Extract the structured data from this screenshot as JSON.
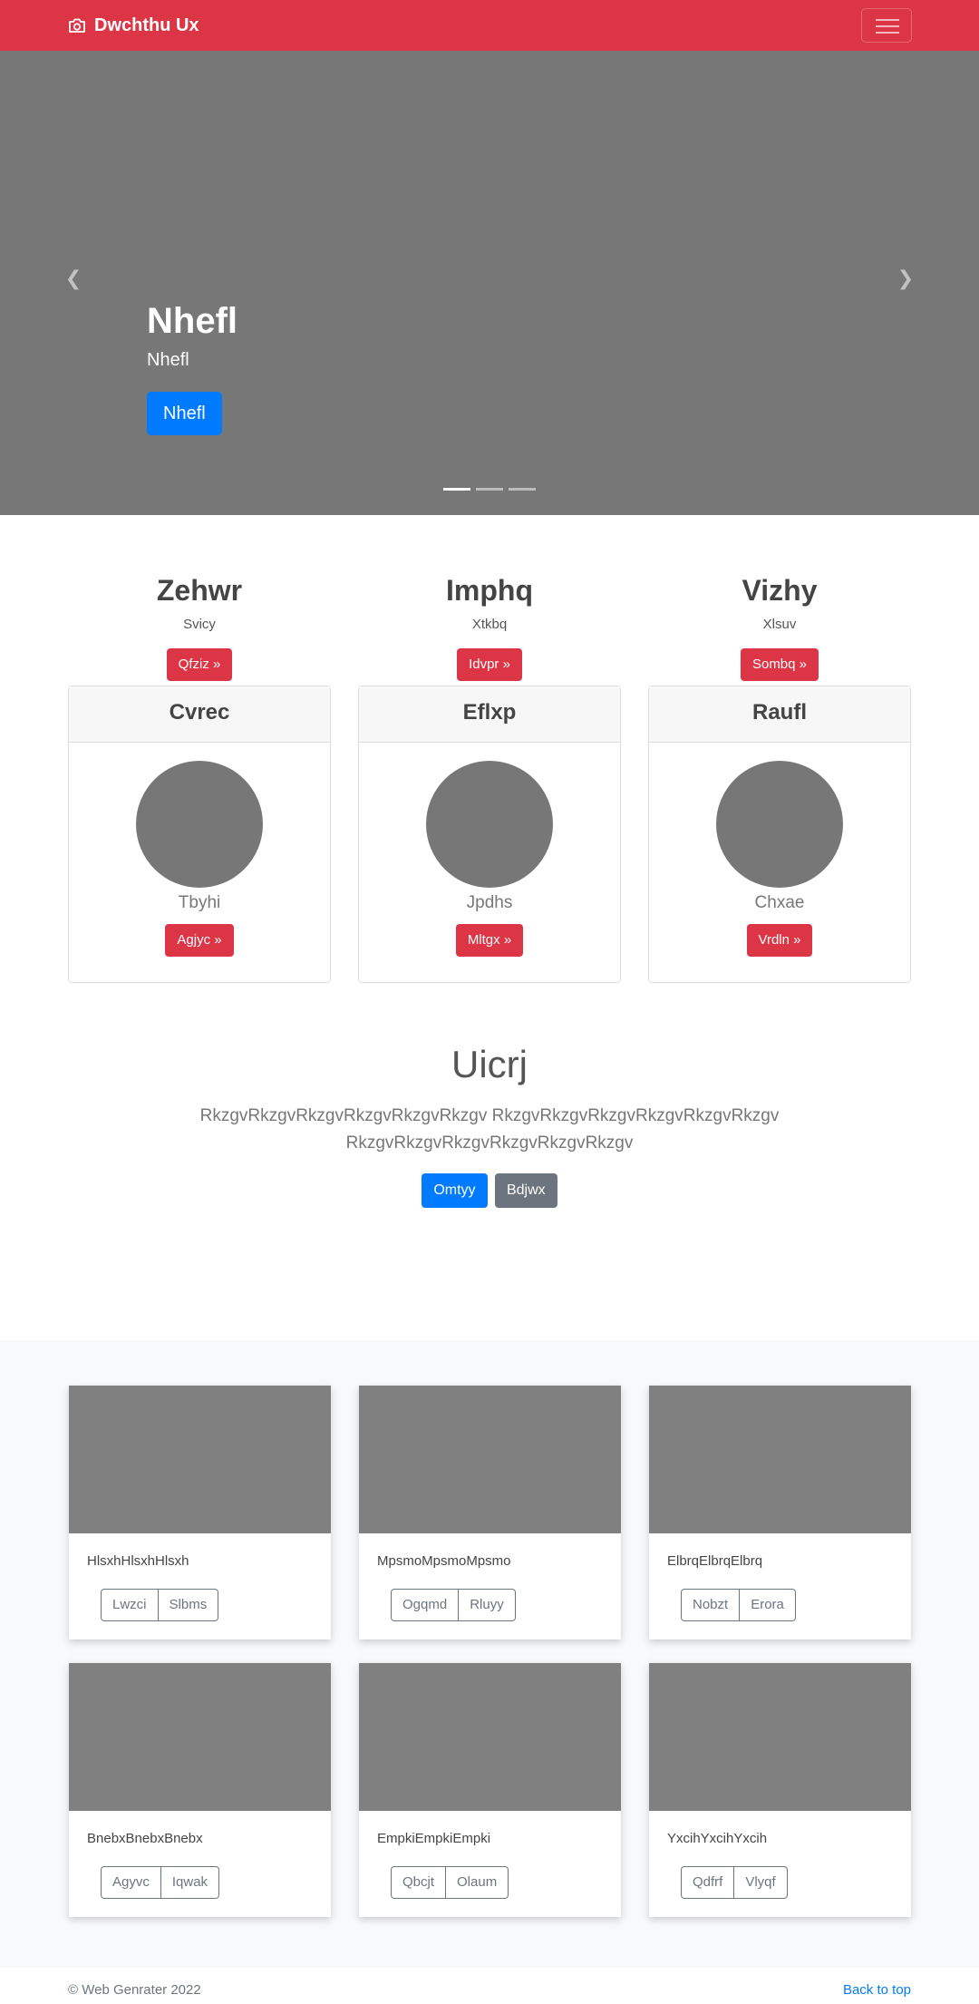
{
  "navbar": {
    "brand": "Dwchthu Ux",
    "brand_icon": "camera-icon",
    "menu_icon": "hamburger-icon"
  },
  "hero": {
    "title": "Nhefl",
    "subtitle": "Nhefl",
    "button": "Nhefl",
    "prev_icon": "chevron-left-icon",
    "next_icon": "chevron-right-icon",
    "slides": 3,
    "active_slide": 1
  },
  "columns": [
    {
      "title": "Zehwr",
      "text": "Svicy",
      "button": "Qfziz »"
    },
    {
      "title": "Imphq",
      "text": "Xtkbq",
      "button": "Idvpr »"
    },
    {
      "title": "Vizhy",
      "text": "Xlsuv",
      "button": "Sombq »"
    }
  ],
  "profiles": [
    {
      "header": "Cvrec",
      "name": "Tbyhi",
      "button": "Agjyc »"
    },
    {
      "header": "Eflxp",
      "name": "Jpdhs",
      "button": "Mltgx »"
    },
    {
      "header": "Raufl",
      "name": "Chxae",
      "button": "Vrdln »"
    }
  ],
  "jumbotron": {
    "title": "Uicrj",
    "text": "RkzgvRkzgvRkzgvRkzgvRkzgvRkzgv RkzgvRkzgvRkzgvRkzgvRkzgvRkzgv RkzgvRkzgvRkzgvRkzgvRkzgvRkzgv",
    "primary_button": "Omtyy",
    "secondary_button": "Bdjwx"
  },
  "album": [
    {
      "title": "HlsxhHlsxhHlsxh",
      "btn1": "Lwzci",
      "btn2": "Slbms"
    },
    {
      "title": "MpsmoMpsmoMpsmo",
      "btn1": "Ogqmd",
      "btn2": "Rluyy"
    },
    {
      "title": "ElbrqElbrqElbrq",
      "btn1": "Nobzt",
      "btn2": "Erora"
    },
    {
      "title": "BnebxBnebxBnebx",
      "btn1": "Agyvc",
      "btn2": "Iqwak"
    },
    {
      "title": "EmpkiEmpkiEmpki",
      "btn1": "Qbcjt",
      "btn2": "Olaum"
    },
    {
      "title": "YxcihYxcihYxcih",
      "btn1": "Qdfrf",
      "btn2": "Vlyqf"
    }
  ],
  "footer": {
    "copyright": "© Web Genrater 2022",
    "back_to_top": "Back to top"
  },
  "colors": {
    "brand": "#dc3545",
    "primary": "#007bff",
    "secondary": "#6c757d",
    "placeholder": "#777777"
  }
}
